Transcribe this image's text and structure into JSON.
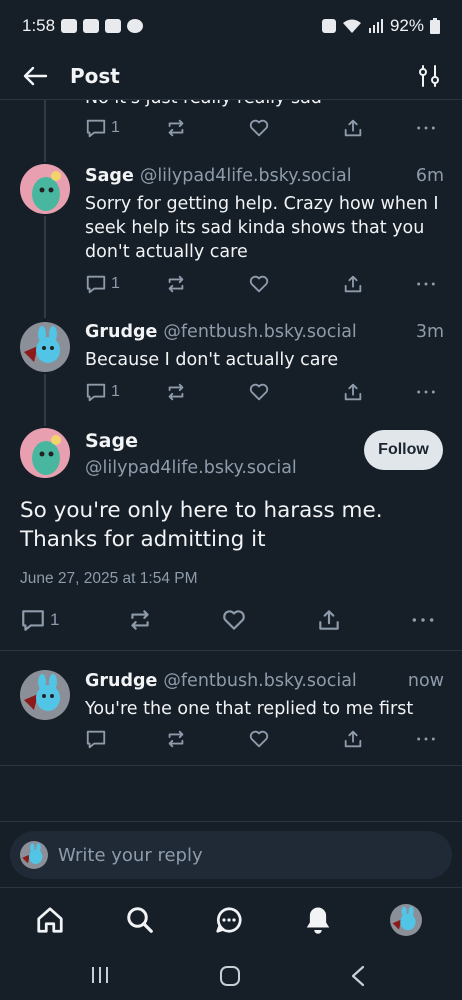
{
  "status_bar": {
    "time": "1:58",
    "battery": "92%",
    "left_icons": [
      "app-icon",
      "app-icon",
      "photo-icon",
      "threads-icon"
    ],
    "right_icons": [
      "nfc-icon",
      "wifi-icon",
      "signal-icon",
      "battery-icon"
    ]
  },
  "app_bar": {
    "title": "Post",
    "back_icon": "arrow-left-icon",
    "filter_icon": "tune-icon"
  },
  "partial_post": {
    "text": "No it's just really really sad",
    "reply_count": "1"
  },
  "posts": [
    {
      "name": "Sage",
      "handle": "@lilypad4life.bsky.social",
      "time": "6m",
      "text": "Sorry for getting help. Crazy how when I seek help its sad kinda shows that you don't actually care",
      "reply_count": "1"
    },
    {
      "name": "Grudge",
      "handle": "@fentbush.bsky.social",
      "time": "3m",
      "text": "Because I don't actually care",
      "reply_count": "1"
    }
  ],
  "main_post": {
    "name": "Sage",
    "handle": "@lilypad4life.bsky.social",
    "follow_label": "Follow",
    "text": "So you're only here to harass me. Thanks for admitting it",
    "date": "June 27, 2025 at 1:54 PM",
    "reply_count": "1"
  },
  "reply_post": {
    "name": "Grudge",
    "handle": "@fentbush.bsky.social",
    "time": "now",
    "text": "You're the one that replied to me first"
  },
  "composer": {
    "placeholder": "Write your reply"
  },
  "bottom_nav": [
    "home-icon",
    "search-icon",
    "chat-icon",
    "notifications-icon",
    "profile-avatar"
  ],
  "colors": {
    "background": "#161e27",
    "text": "#f1f3f5",
    "muted": "#8d9bab",
    "divider": "#2a3440",
    "follow_bg": "#e1e6eb"
  }
}
